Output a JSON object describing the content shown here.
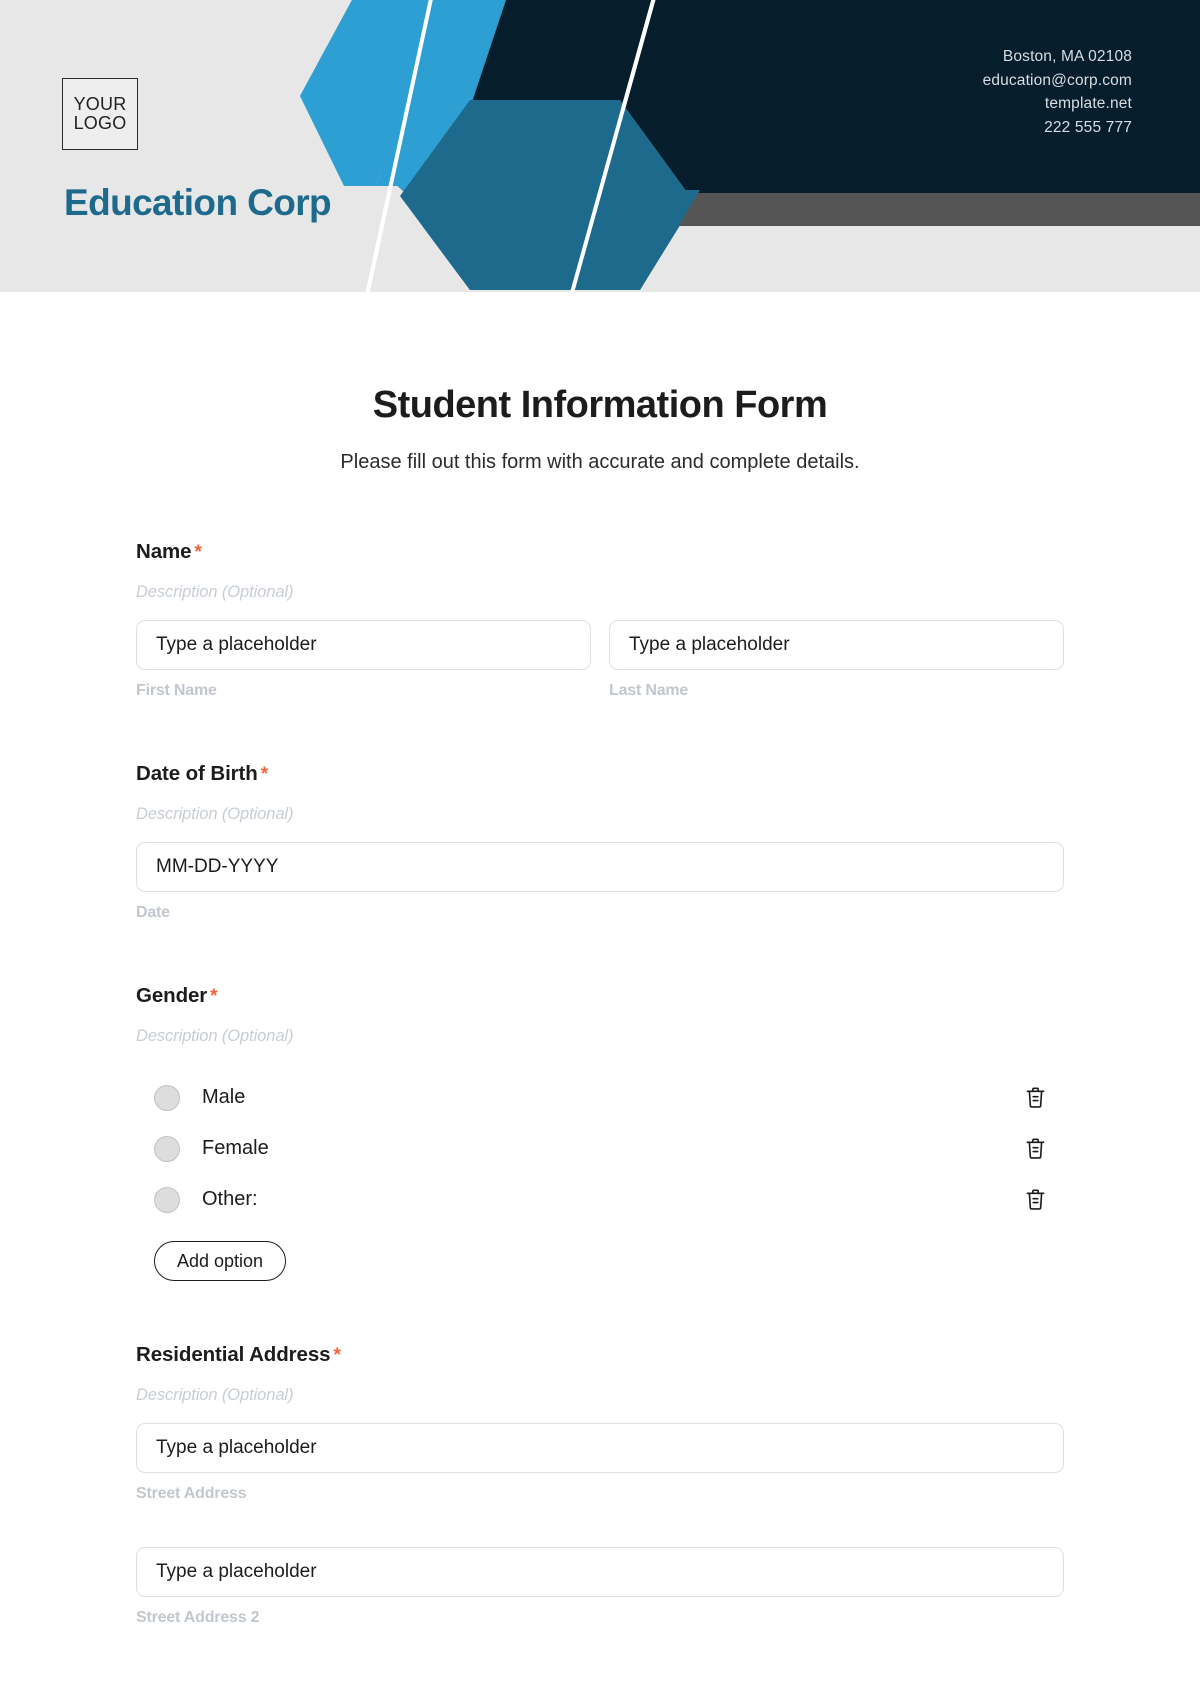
{
  "header": {
    "logo": {
      "line1": "YOUR",
      "line2": "LOGO"
    },
    "company_name": "Education Corp",
    "contact": {
      "address": "Boston, MA 02108",
      "email": "education@corp.com",
      "website": "template.net",
      "phone": "222 555 777"
    },
    "colors": {
      "background": "#e7e7e7",
      "navy": "#061e2c",
      "light_blue": "#2d9fd3",
      "mid_blue": "#1d6a8c",
      "gray_bar": "#555555",
      "brand_text": "#1d6a8c"
    }
  },
  "form": {
    "title": "Student Information Form",
    "subtitle": "Please fill out this form with accurate and complete details.",
    "required_marker": "*",
    "description_placeholder": "Description (Optional)",
    "input_placeholder": "Type a placeholder",
    "fields": [
      {
        "id": "name",
        "label": "Name",
        "required": true,
        "description": "Description (Optional)",
        "type": "name",
        "inputs": [
          {
            "value": "Type a placeholder",
            "sub_label": "First Name"
          },
          {
            "value": "Type a placeholder",
            "sub_label": "Last Name"
          }
        ]
      },
      {
        "id": "date-of-birth",
        "label": "Date of Birth",
        "required": true,
        "description": "Description (Optional)",
        "type": "date",
        "inputs": [
          {
            "value": "MM-DD-YYYY",
            "sub_label": "Date"
          }
        ]
      },
      {
        "id": "gender",
        "label": "Gender",
        "required": true,
        "description": "Description (Optional)",
        "type": "radio",
        "options": [
          {
            "label": "Male",
            "delete_icon": "trash-icon"
          },
          {
            "label": "Female",
            "delete_icon": "trash-icon"
          },
          {
            "label": "Other:",
            "delete_icon": "trash-icon"
          }
        ],
        "add_option_label": "Add option"
      },
      {
        "id": "residential-address",
        "label": "Residential Address",
        "required": true,
        "description": "Description (Optional)",
        "type": "address",
        "inputs": [
          {
            "value": "Type a placeholder",
            "sub_label": "Street Address"
          },
          {
            "value": "Type a placeholder",
            "sub_label": "Street Address 2"
          }
        ]
      }
    ]
  }
}
